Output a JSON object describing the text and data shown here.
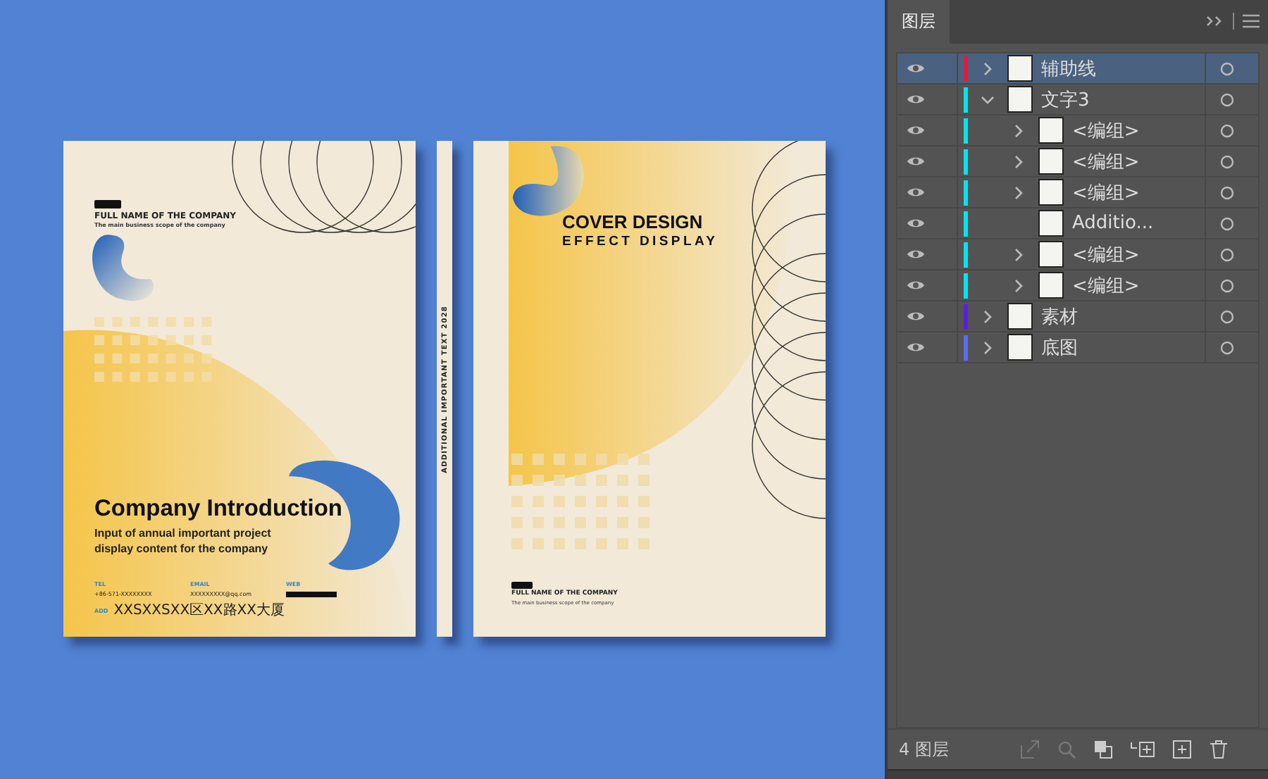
{
  "back_cover": {
    "company_name": "FULL NAME OF THE COMPANY",
    "scope": "The main business scope of the company",
    "title": "Company Introduction",
    "subtitle_lines": [
      "Input of annual important project",
      "display content for the company"
    ],
    "contacts": [
      {
        "label": "TEL",
        "value": "+86-571-XXXXXXXX"
      },
      {
        "label": "EMAIL",
        "value": "XXXXXXXXX@qq.com"
      },
      {
        "label": "WEB"
      }
    ],
    "address": {
      "label": "ADD",
      "value": "XXSXXSXX区XX路XX大厦"
    }
  },
  "spine": {
    "text": "ADDITIONAL IMPORTANT TEXT 2028"
  },
  "front_cover": {
    "title": "COVER DESIGN",
    "subtitle": "EFFECT DISPLAY",
    "company_name": "FULL NAME OF THE COMPANY",
    "scope": "The main business scope of the company"
  },
  "layers_panel": {
    "tab": "图层",
    "layers": [
      {
        "name": "辅助线",
        "color": "#e8173c",
        "selected": true,
        "expanded": false
      },
      {
        "name": "文字3",
        "color": "#00e5ee",
        "selected": false,
        "expanded": true,
        "children": [
          {
            "name": "<编组>",
            "color": "#00e5ee",
            "selected": false,
            "expanded": false
          },
          {
            "name": "<编组>",
            "color": "#00e5ee",
            "selected": false,
            "expanded": false
          },
          {
            "name": "<编组>",
            "color": "#00e5ee",
            "selected": false,
            "expanded": false
          },
          {
            "name": "Additio...",
            "color": "#00e5ee",
            "selected": false
          },
          {
            "name": "<编组>",
            "color": "#00e5ee",
            "selected": false,
            "expanded": false
          },
          {
            "name": "<编组>",
            "color": "#00e5ee",
            "selected": false,
            "expanded": false
          }
        ]
      },
      {
        "name": "素材",
        "color": "#5a1fe0",
        "selected": false,
        "expanded": false
      },
      {
        "name": "底图",
        "color": "#5c6cf0",
        "selected": false,
        "expanded": false
      }
    ],
    "footer": {
      "count": "4 图层"
    }
  }
}
